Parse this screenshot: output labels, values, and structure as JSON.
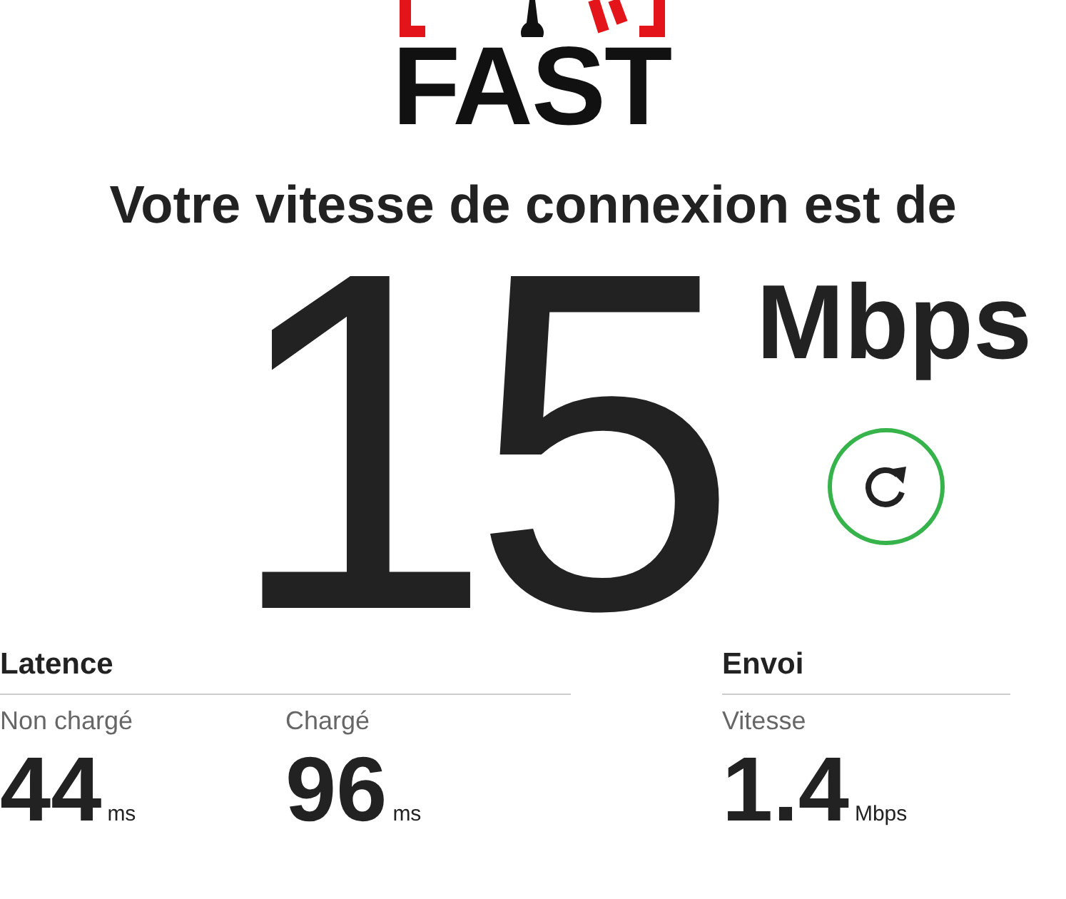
{
  "logo": {
    "text": "FAST"
  },
  "title": "Votre vitesse de connexion est de",
  "speed": {
    "value": "15",
    "unit": "Mbps"
  },
  "sections": [
    {
      "heading": "Latence",
      "metrics": [
        {
          "label": "Non chargé",
          "value": "44",
          "unit": "ms"
        },
        {
          "label": "Chargé",
          "value": "96",
          "unit": "ms"
        }
      ]
    },
    {
      "heading": "Envoi",
      "metrics": [
        {
          "label": "Vitesse",
          "value": "1.4",
          "unit": "Mbps"
        }
      ]
    }
  ]
}
